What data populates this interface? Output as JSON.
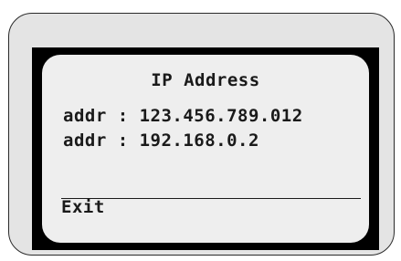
{
  "screen": {
    "title": "IP Address",
    "addresses": [
      "addr : 123.456.789.012",
      "addr : 192.168.0.2"
    ],
    "exit_label": "Exit"
  },
  "colors": {
    "device_body": "#e4e4e4",
    "bezel": "#000000",
    "lcd_background": "#eeeeee",
    "lcd_text": "#1a1a1a"
  }
}
